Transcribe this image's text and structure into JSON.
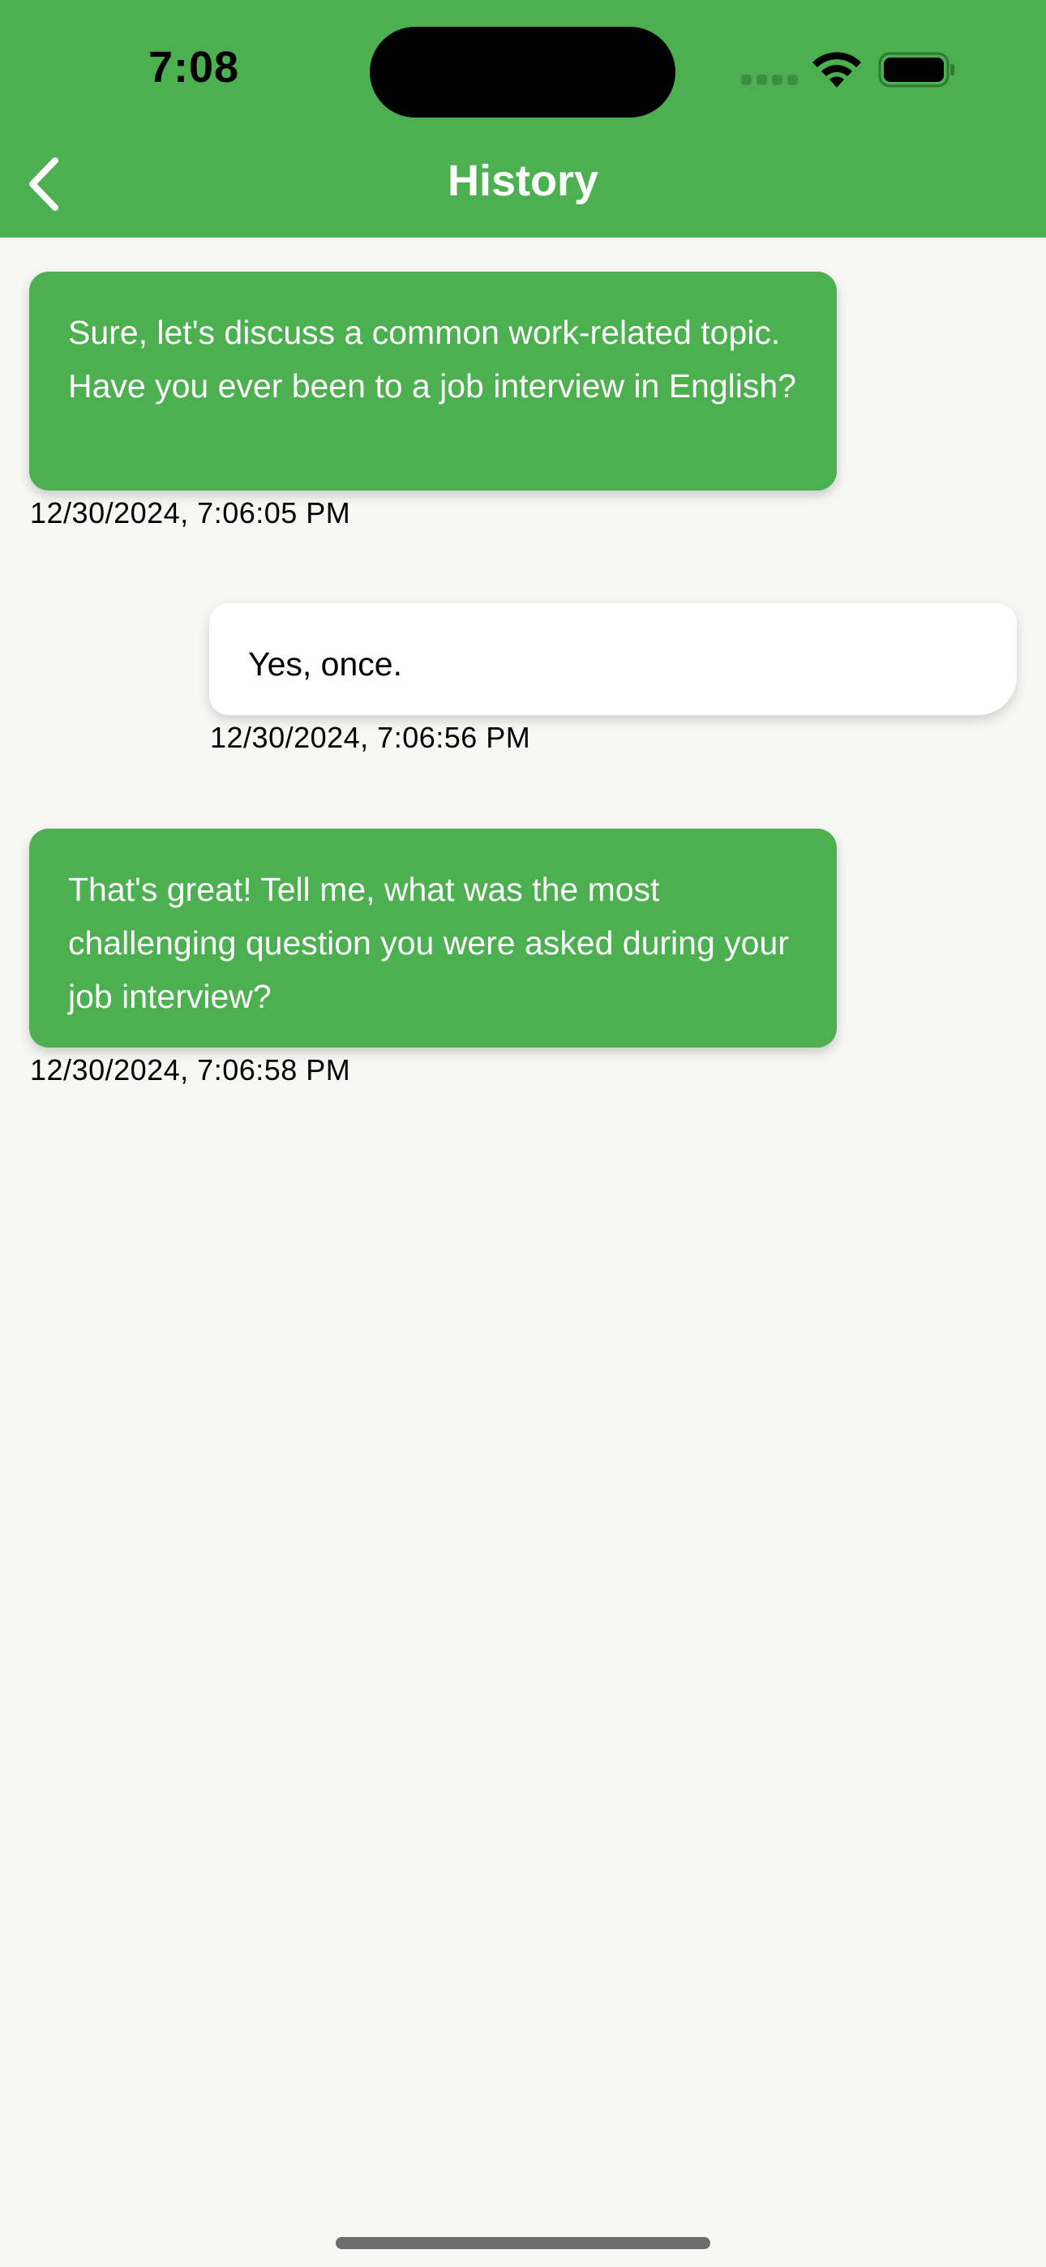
{
  "status_bar": {
    "time": "7:08"
  },
  "nav": {
    "title": "History",
    "back_icon": "chevron-left-icon"
  },
  "messages": [
    {
      "role": "assistant",
      "text": "Sure, let's discuss a common work-related topic. Have you ever been to a job interview in English?",
      "timestamp": "12/30/2024, 7:06:05 PM"
    },
    {
      "role": "user",
      "text": "Yes, once.",
      "timestamp": "12/30/2024, 7:06:56 PM"
    },
    {
      "role": "assistant",
      "text": "That's great! Tell me, what was the most challenging question you were asked during your job interview?",
      "timestamp": "12/30/2024, 7:06:58 PM"
    }
  ],
  "colors": {
    "accent": "#4caf50",
    "background": "#f7f7f5",
    "user_bubble": "#ffffff"
  }
}
